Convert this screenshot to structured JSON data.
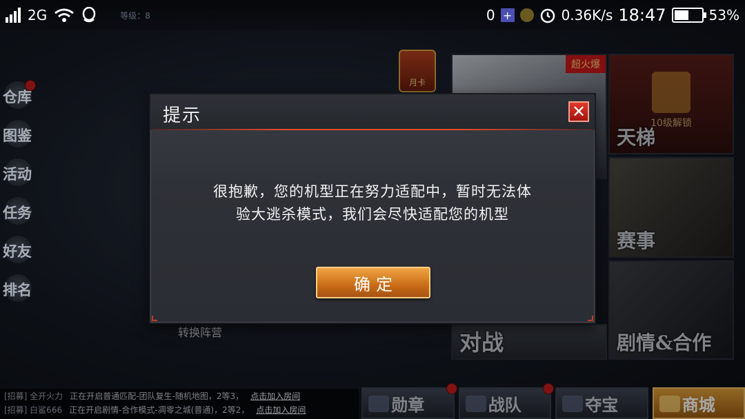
{
  "status_bar": {
    "network": "2G",
    "faint_level_label": "等级：8",
    "currency_count": "0",
    "net_speed": "0.36K/s",
    "time": "18:47",
    "battery_pct": "53%",
    "battery_level": 0.53
  },
  "left_menu": [
    {
      "label": "仓库",
      "icon": "warehouse-icon",
      "alert": true
    },
    {
      "label": "图鉴",
      "icon": "crosshair-icon",
      "alert": false
    },
    {
      "label": "活动",
      "icon": "event-icon",
      "alert": false
    },
    {
      "label": "任务",
      "icon": "quest-icon",
      "alert": false
    },
    {
      "label": "好友",
      "icon": "friends-icon",
      "alert": false
    },
    {
      "label": "排名",
      "icon": "rank-icon",
      "alert": false
    }
  ],
  "monthly_card": {
    "label": "月卡"
  },
  "tiles": {
    "super_burst": {
      "badge": "超火爆"
    },
    "ladder": {
      "title": "天梯",
      "lock_text": "10级解锁"
    },
    "match": {
      "title": "赛事"
    },
    "battle": {
      "title": "对战"
    },
    "story": {
      "title": "剧情&合作"
    }
  },
  "switch_camp": "转换阵营",
  "chat": [
    {
      "tag": "[招募] 全开火力",
      "msg": "正在开启普通匹配-团队复生-随机地图，2等3，",
      "link": "点击加入房间"
    },
    {
      "tag": "[招募] 白鲨666",
      "msg": "正在开启剧情-合作模式-凋零之城(普通)，2等2，",
      "link": "点击加入房间"
    }
  ],
  "bottom_nav": [
    {
      "label": "勋章",
      "alert": true
    },
    {
      "label": "战队",
      "alert": true
    },
    {
      "label": "夺宝",
      "alert": false
    },
    {
      "label": "商城",
      "alert": false
    }
  ],
  "dialog": {
    "title": "提示",
    "close": "✕",
    "message_line1": "很抱歉，您的机型正在努力适配中，暂时无法体",
    "message_line2": "验大逃杀模式，我们会尽快适配您的机型",
    "confirm_label": "确定"
  }
}
